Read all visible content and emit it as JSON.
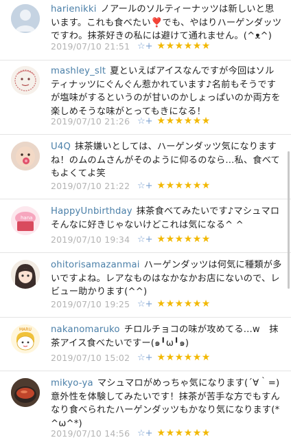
{
  "reviews": [
    {
      "user": "harienikki",
      "text": "ノアールのソルティーナッツは新しいと思います。これも食べたい❣️でも、やはりハーゲンダッツですわ。抹茶好きの私には避けて通れません。(^ᴥ^)",
      "date": "2019/07/10 21:51",
      "fav_icon": "☆+",
      "stars": "★★★★★★",
      "avatar": "default-person-icon"
    },
    {
      "user": "mashley_slt",
      "text": "夏といえばアイスなんですが今回はソルティナッツにぐんぐん惹かれています♪名前もそうですが塩味がするというのが甘いのかしょっぱいのか両方を楽しめそうな味がとってもきになる！",
      "date": "2019/07/10 21:26",
      "fav_icon": "☆+",
      "stars": "★★★★★★",
      "avatar": "sketch-face-avatar"
    },
    {
      "user": "U4Q",
      "text": "抹茶嫌いとしては、ハーゲンダッツ気になりますね！のムのムさんがそのように仰るのなら...私、食べてもよくてよ笑",
      "date": "2019/07/10 21:22",
      "fav_icon": "☆+",
      "stars": "★★★★★★",
      "avatar": "baby-photo-avatar"
    },
    {
      "user": "HappyUnbirthday",
      "text": "抹茶食べてみたいです♪マシュマロそんなに好きじゃないけどこれは気になる^ ^",
      "date": "2019/07/10 19:34",
      "fav_icon": "☆+",
      "stars": "★★★★★★",
      "avatar": "cupcake-avatar"
    },
    {
      "user": "ohitorisamazanmai",
      "text": "ハーゲンダッツは何気に種類が多いですよね。レアなものはなかなかお店にないので、レビュー助かります(^^)",
      "date": "2019/07/10 19:25",
      "fav_icon": "☆+",
      "stars": "★★★★★★",
      "avatar": "anime-girl-avatar"
    },
    {
      "user": "nakanomaruko",
      "text": "チロルチョコの味が攻めてる...w　抹茶アイス食べたいですー(๑╹ω╹๑)",
      "date": "2019/07/10 15:02",
      "fav_icon": "☆+",
      "stars": "★★★★★★",
      "avatar": "cartoon-character-avatar",
      "avatar_label": "MARU"
    },
    {
      "user": "mikyo-ya",
      "text": "マシュマロがめっちゃ気になります(´∀｀=)意外性を体験してみたいです！抹茶が苦手な方でもすんなり食べられたハーゲンダッツもかなり気になります(*^ω^*)",
      "date": "2019/07/10 14:56",
      "fav_icon": "☆+",
      "stars": "★★★★★★",
      "avatar": "food-photo-avatar"
    }
  ],
  "cupcake_label": "hana"
}
